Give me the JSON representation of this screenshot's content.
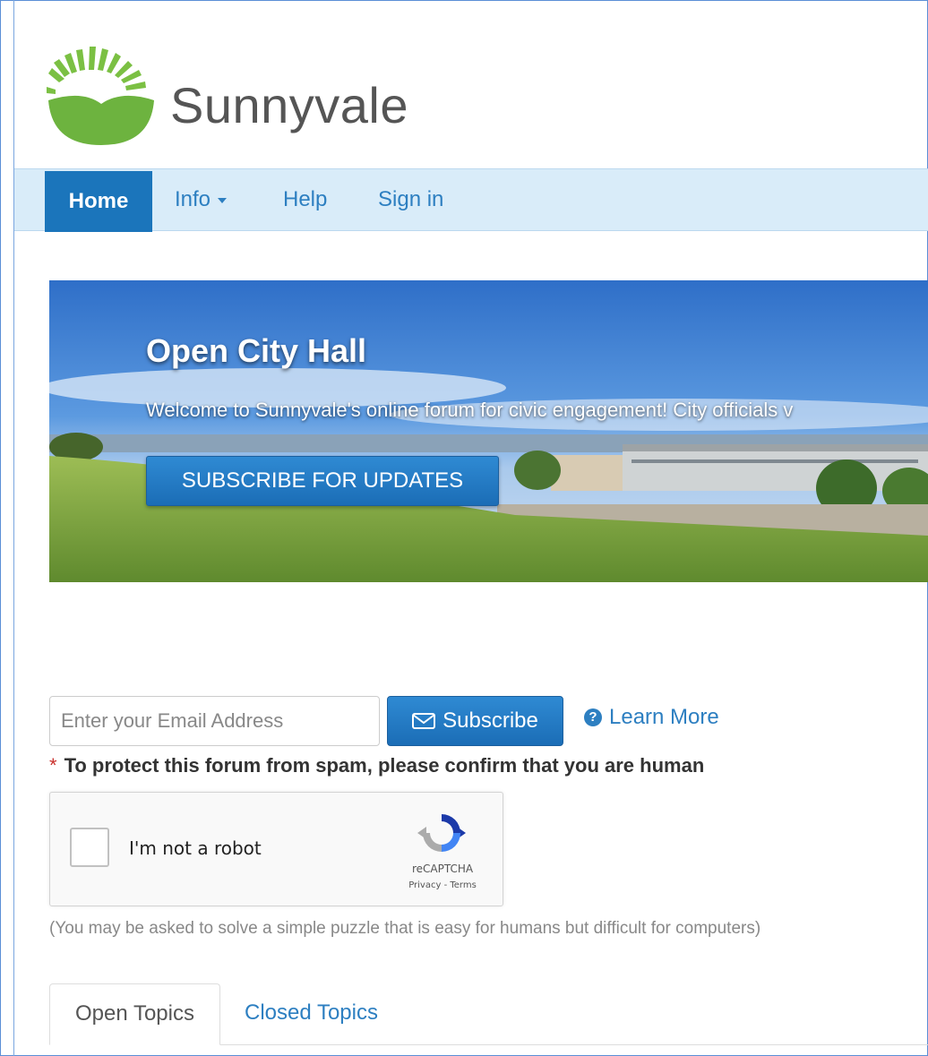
{
  "header": {
    "brand_name": "Sunnyvale",
    "logo_icon": "sunrise-logo-icon",
    "brand_color": "#6db33f"
  },
  "nav": {
    "items": [
      {
        "label": "Home",
        "active": true
      },
      {
        "label": "Info",
        "has_dropdown": true
      },
      {
        "label": "Help"
      },
      {
        "label": "Sign in"
      }
    ],
    "background": "#d9ecf9",
    "active_color": "#1b75bb"
  },
  "hero": {
    "title": "Open City Hall",
    "text": "Welcome to Sunnyvale's online forum for civic engagement! City officials v",
    "button_label": "SUBSCRIBE FOR UPDATES"
  },
  "subscribe": {
    "email_placeholder": "Enter your Email Address",
    "button_label": "Subscribe",
    "button_icon": "envelope-icon",
    "learn_more_label": "Learn More",
    "learn_more_icon": "question-circle-icon"
  },
  "captcha": {
    "required_marker": "*",
    "prompt": "To protect this forum from spam, please confirm that you are human",
    "checkbox_label": "I'm not a robot",
    "brand": "reCAPTCHA",
    "links": "Privacy - Terms",
    "note": "(You may be asked to solve a simple puzzle that is easy for humans but difficult for computers)"
  },
  "tabs": [
    {
      "label": "Open Topics",
      "active": true
    },
    {
      "label": "Closed Topics",
      "active": false
    }
  ]
}
